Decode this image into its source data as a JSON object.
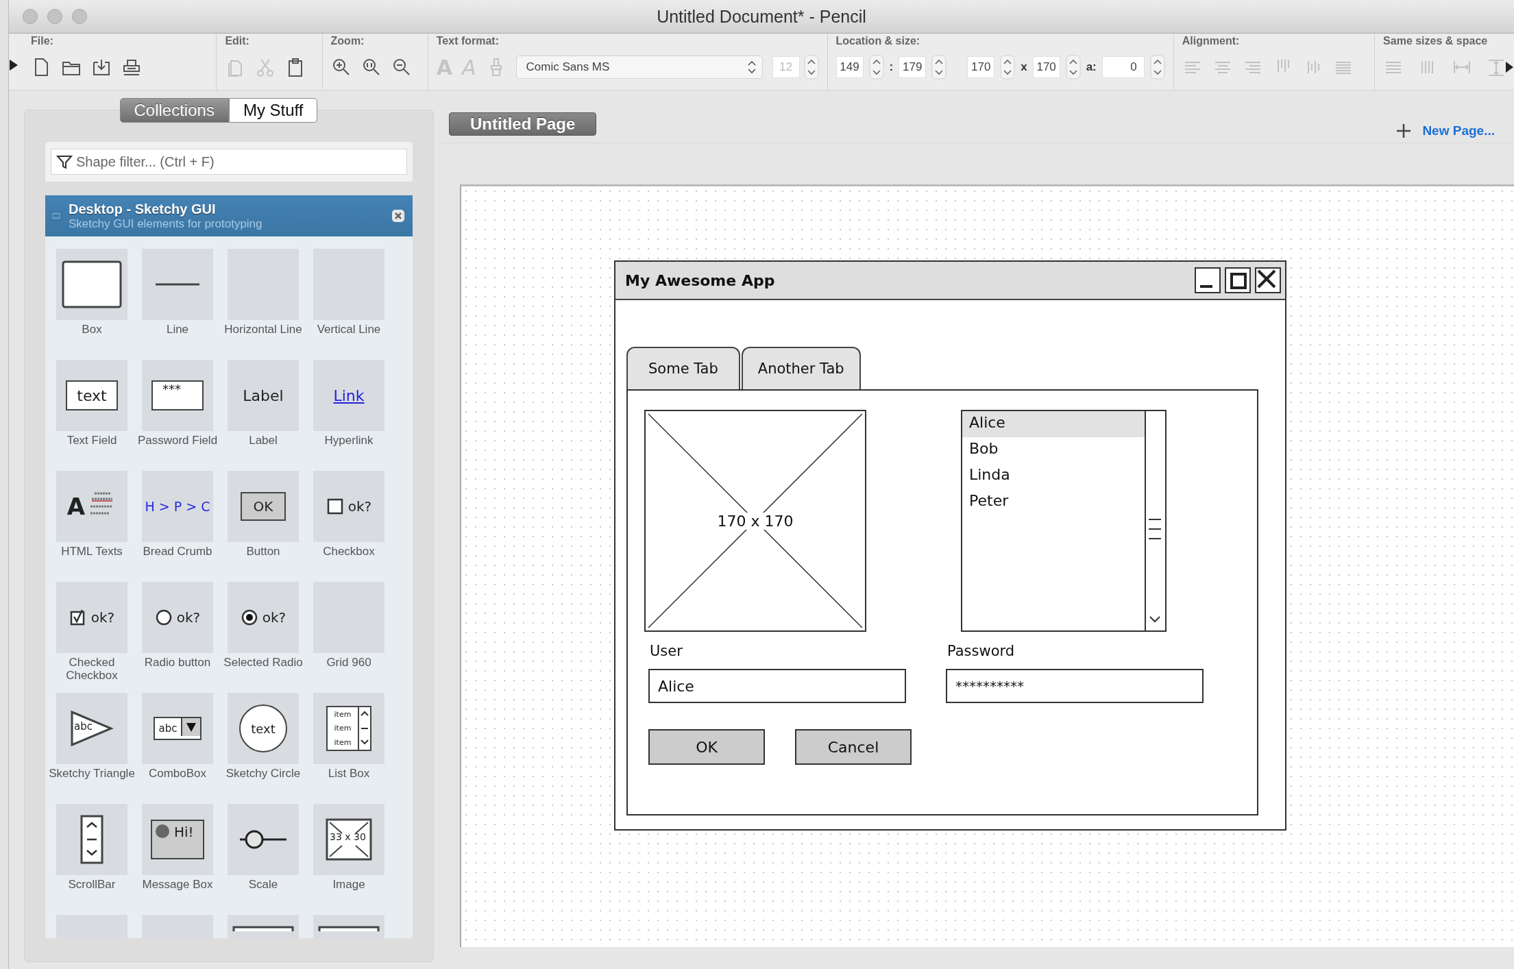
{
  "window": {
    "title": "Untitled Document* - Pencil"
  },
  "toolbar": {
    "groups": [
      {
        "kind": "file",
        "label": "File:",
        "disabled": false
      },
      {
        "kind": "edit",
        "label": "Edit:",
        "disabled": false
      },
      {
        "kind": "zoom",
        "label": "Zoom:",
        "disabled": false
      },
      {
        "kind": "text_format",
        "label": "Text format:",
        "disabled": true,
        "style_buttons": [
          "A",
          "A"
        ],
        "font": "Comic Sans MS",
        "size": "12"
      },
      {
        "kind": "location",
        "label": "Location & size:",
        "disabled": false,
        "items": [
          {
            "kind": "field",
            "value": "149"
          },
          {
            "kind": "sep",
            "text": ":"
          },
          {
            "kind": "field",
            "value": "179"
          },
          {
            "kind": "gap"
          },
          {
            "kind": "field",
            "value": "170"
          },
          {
            "kind": "sep",
            "text": "x"
          },
          {
            "kind": "field",
            "value": "170"
          },
          {
            "kind": "sep",
            "text": "a:"
          },
          {
            "kind": "wide_field",
            "value": "0"
          }
        ]
      },
      {
        "kind": "alignment",
        "label": "Alignment:",
        "disabled": true
      },
      {
        "kind": "same_sizes",
        "label": "Same sizes & space",
        "disabled": true
      }
    ]
  },
  "sidebar": {
    "tabs": [
      {
        "label": "Collections",
        "selected": true
      },
      {
        "label": "My Stuff",
        "selected": false
      }
    ],
    "filter": {
      "placeholder": "Shape filter... (Ctrl + F)"
    },
    "collection": {
      "title": "Desktop - Sketchy GUI",
      "subtitle": "Sketchy GUI elements for prototyping",
      "expanded": true
    },
    "shapes": [
      {
        "kind": "box",
        "label": "Box"
      },
      {
        "kind": "line",
        "label": "Line"
      },
      {
        "kind": "blank",
        "label": "Horizontal Line"
      },
      {
        "kind": "blank",
        "label": "Vertical Line"
      },
      {
        "kind": "text_field",
        "label": "Text Field",
        "preview": "text"
      },
      {
        "kind": "password_field",
        "label": "Password Field",
        "preview": "***"
      },
      {
        "kind": "label",
        "label": "Label",
        "preview": "Label"
      },
      {
        "kind": "hyperlink",
        "label": "Hyperlink",
        "preview": "Link"
      },
      {
        "kind": "html_texts",
        "label": "HTML Texts",
        "preview": "A"
      },
      {
        "kind": "breadcrumb",
        "label": "Bread Crumb",
        "preview": "H > P > C"
      },
      {
        "kind": "button",
        "label": "Button",
        "preview": "OK"
      },
      {
        "kind": "checkbox",
        "label": "Checkbox",
        "preview": "ok?"
      },
      {
        "kind": "checked_checkbox",
        "label": "Checked Checkbox",
        "preview": "ok?"
      },
      {
        "kind": "radio",
        "label": "Radio button",
        "preview": "ok?"
      },
      {
        "kind": "selected_radio",
        "label": "Selected Radio",
        "preview": "ok?"
      },
      {
        "kind": "blank",
        "label": "Grid 960"
      },
      {
        "kind": "triangle",
        "label": "Sketchy Triangle",
        "preview": "abc"
      },
      {
        "kind": "combobox",
        "label": "ComboBox",
        "preview": "abc"
      },
      {
        "kind": "circle",
        "label": "Sketchy Circle",
        "preview": "text"
      },
      {
        "kind": "listbox",
        "label": "List Box",
        "preview_items": [
          "item",
          "item",
          "item"
        ]
      },
      {
        "kind": "scrollbar",
        "label": "ScrollBar"
      },
      {
        "kind": "messagebox",
        "label": "Message Box",
        "preview": "Hi!"
      },
      {
        "kind": "scale",
        "label": "Scale"
      },
      {
        "kind": "image",
        "label": "Image",
        "preview": "33 x 30"
      },
      {
        "kind": "blank"
      },
      {
        "kind": "blank"
      },
      {
        "kind": "partial_box"
      },
      {
        "kind": "partial_box"
      }
    ]
  },
  "pages": {
    "tabs": [
      {
        "label": "Untitled Page",
        "selected": true
      }
    ],
    "new_page": "New Page..."
  },
  "mockup": {
    "title": "My Awesome App",
    "tabs": [
      {
        "label": "Some Tab"
      },
      {
        "label": "Another Tab"
      }
    ],
    "image_placeholder": "170 x 170",
    "list_items": [
      {
        "text": "Alice",
        "selected": true
      },
      {
        "text": "Bob",
        "selected": false
      },
      {
        "text": "Linda",
        "selected": false
      },
      {
        "text": "Peter",
        "selected": false
      }
    ],
    "fields": [
      {
        "label": "User",
        "value": "Alice"
      },
      {
        "label": "Password",
        "value": "**********"
      }
    ],
    "buttons": [
      "OK",
      "Cancel"
    ]
  }
}
